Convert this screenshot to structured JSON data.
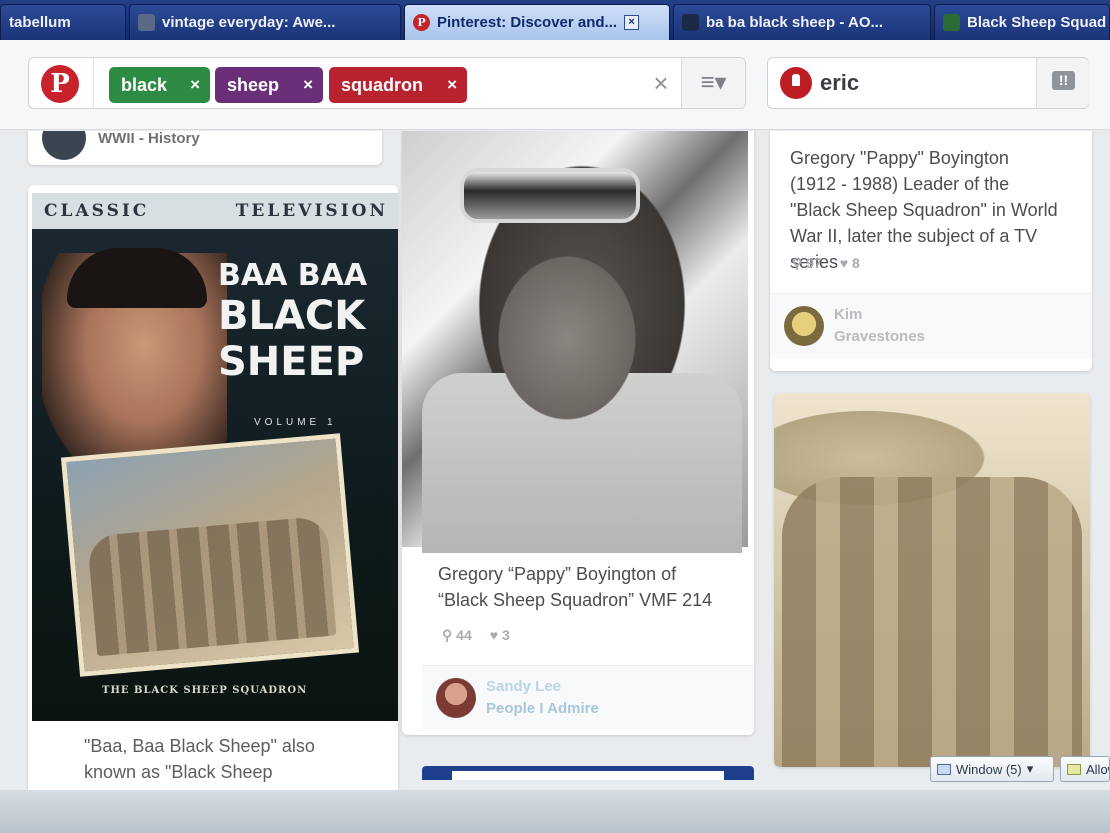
{
  "tabs": [
    {
      "label": "tabellum",
      "icon": "none",
      "active": false
    },
    {
      "label": "vintage everyday: Awe...",
      "icon": "site",
      "active": false
    },
    {
      "label": "Pinterest: Discover and...",
      "icon": "pinterest",
      "active": true
    },
    {
      "label": "ba ba black sheep - AO...",
      "icon": "aol",
      "active": false
    },
    {
      "label": "Black Sheep Squad",
      "icon": "site",
      "active": false
    }
  ],
  "header": {
    "logo": "P",
    "chips": [
      {
        "label": "black",
        "color": "#2e8b43"
      },
      {
        "label": "sheep",
        "color": "#6a2f78"
      },
      {
        "label": "squadron",
        "color": "#b8232f"
      }
    ],
    "chip_remove": "×",
    "clear": "×",
    "menu": "≡▾",
    "user_name": "eric",
    "notif_glyph": "!!"
  },
  "pins": {
    "top_board": {
      "name": "WWII - History"
    },
    "dvd": {
      "band_left": "CLASSIC",
      "band_right": "TELEVISION",
      "title_1": "BAA BAA",
      "title_2": "BLACK",
      "title_3": "SHEEP",
      "volume": "VOLUME 1",
      "footer": "THE BLACK SHEEP SQUADRON",
      "caption": "\"Baa, Baa Black Sheep\" also known as \"Black Sheep Squadron\""
    },
    "pappy": {
      "caption": "Gregory “Pappy” Boyington of “Black Sheep Squadron” VMF 214",
      "repins": "44",
      "likes": "3",
      "pinner": "Sandy Lee",
      "board": "People I Admire"
    },
    "pappy_text": {
      "caption": "Gregory \"Pappy\" Boyington (1912 - 1988) Leader of the \"Black Sheep Squadron\" in World War II, later the subject of a TV series",
      "repins": "97",
      "likes": "8",
      "pinner": "Kim",
      "board": "Gravestones"
    }
  },
  "taskbar": {
    "window_btn": "Window (5)",
    "allow_btn": "Allow"
  },
  "glyphs": {
    "repin": "⚲",
    "like": "♥"
  }
}
